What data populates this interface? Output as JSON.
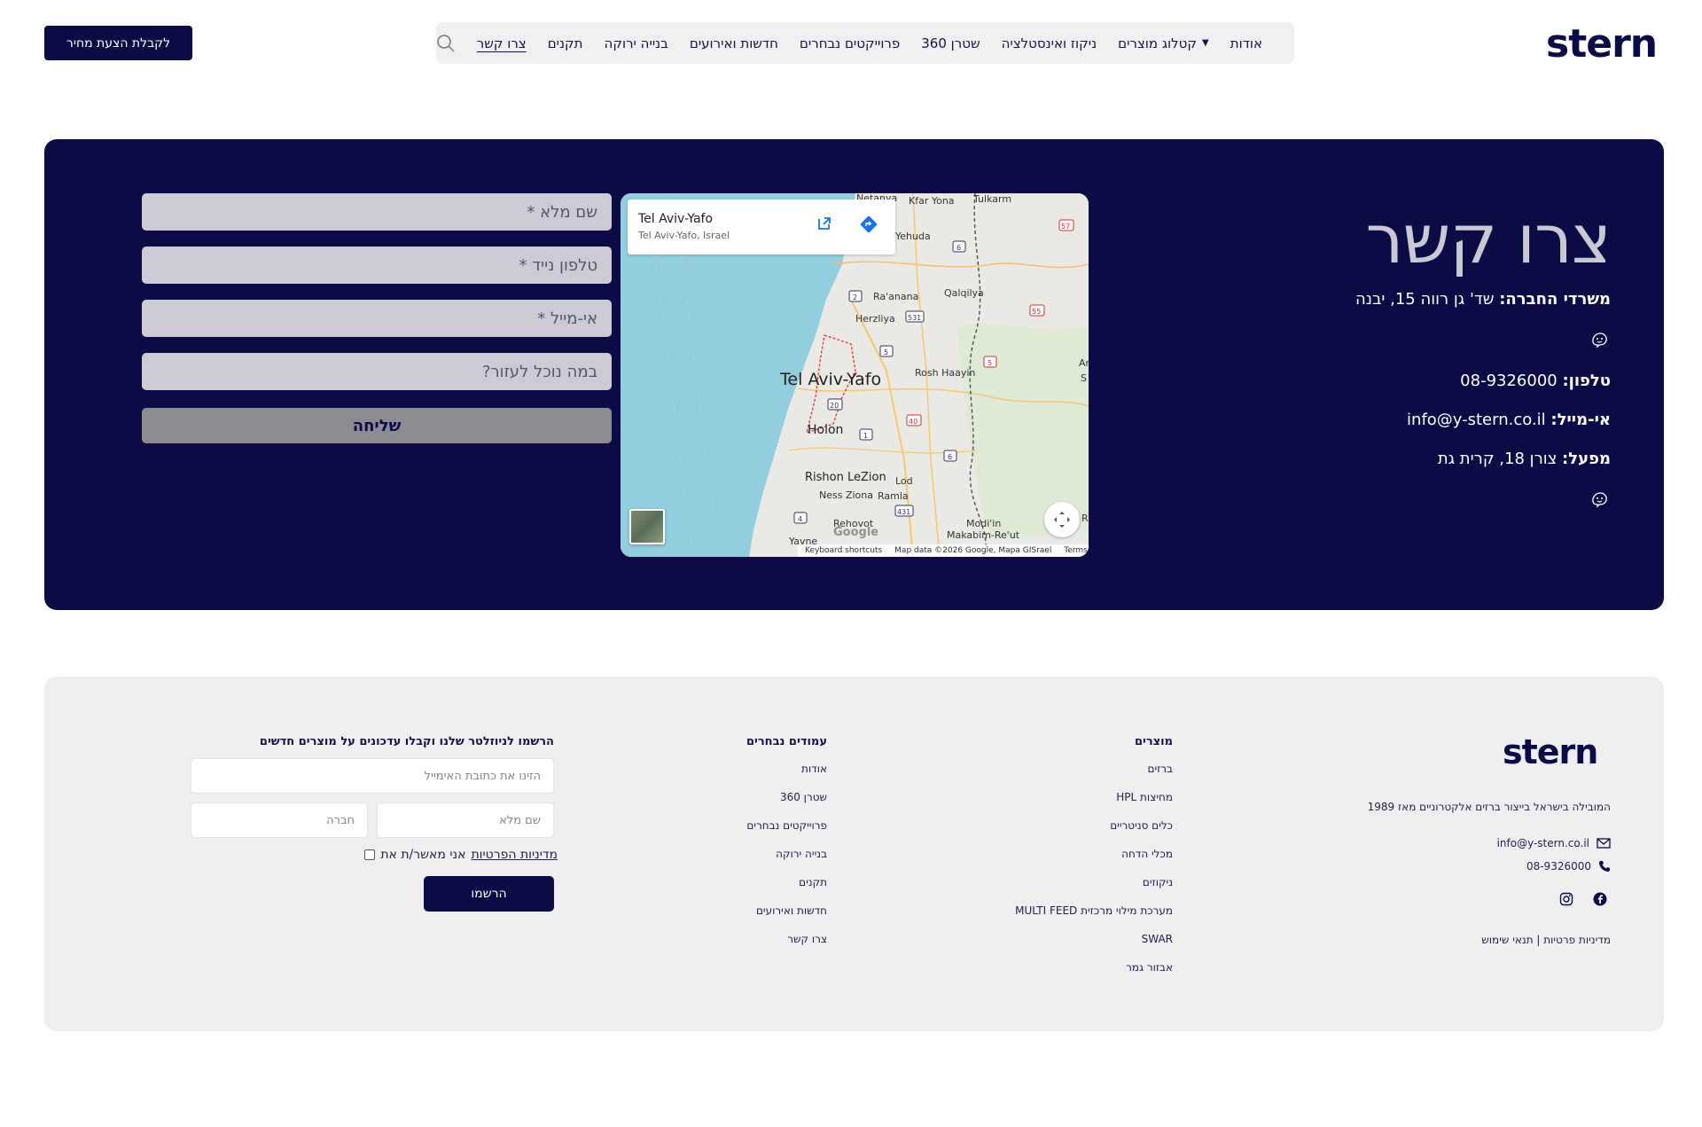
{
  "brand": {
    "logo_text": "stern",
    "color": "#0b0b45"
  },
  "header": {
    "nav": [
      {
        "label": "אודות",
        "has_dropdown": false
      },
      {
        "label": "קטלוג מוצרים",
        "has_dropdown": true
      },
      {
        "label": "ניקוז ואינסטלציה",
        "has_dropdown": false
      },
      {
        "label": "שטרן 360",
        "has_dropdown": false
      },
      {
        "label": "פרוייקטים נבחרים",
        "has_dropdown": false
      },
      {
        "label": "חדשות ואירועים",
        "has_dropdown": false
      },
      {
        "label": "בנייה ירוקה",
        "has_dropdown": false
      },
      {
        "label": "תקנים",
        "has_dropdown": false
      },
      {
        "label": "צרו קשר",
        "has_dropdown": false,
        "active": true
      }
    ],
    "search_icon": "search-icon",
    "quote_button": "לקבלת הצעת מחיר"
  },
  "contact": {
    "title": "צרו קשר",
    "offices_label": "משרדי החברה:",
    "offices_value": "שד' גן רווה 15, יבנה",
    "phone_label": "טלפון:",
    "phone_value": "08-9326000",
    "email_label": "אי-מייל:",
    "email_value": "info@y-stern.co.il",
    "factory_label": "מפעל:",
    "factory_value": "צורן 18, קרית גת",
    "waze_icon": "waze-icon"
  },
  "map": {
    "card_title": "Tel Aviv-Yafo",
    "card_subtitle": "Tel Aviv-Yafo, Israel",
    "labels": {
      "netanya": "Netanya",
      "kfar_yona": "Kfar Yona",
      "tulkarm": "Tulkarm",
      "yehuda": "Yehuda",
      "raanana": "Ra'anana",
      "qalqilya": "Qalqilya",
      "herzliya": "Herzliya",
      "tel_aviv": "Tel Aviv-Yafo",
      "rosh_haayin": "Rosh Haayin",
      "holon": "Holon",
      "rishon": "Rishon LeZion",
      "lod": "Lod",
      "ness_ziona": "Ness Ziona",
      "ramla": "Ramla",
      "rehovot": "Rehovot",
      "yavne": "Yavne",
      "modiin": "Modi'in",
      "makabim": "Makabim-Re'ut",
      "ar": "Ar",
      "s": "S",
      "r": "R"
    },
    "road_shields": [
      "57",
      "6",
      "2",
      "55",
      "531",
      "5",
      "5",
      "20",
      "40",
      "1",
      "6",
      "431",
      "4"
    ],
    "footer": [
      "Keyboard shortcuts",
      "Map data ©2026 Google, Mapa GISrael",
      "Terms"
    ],
    "google": "Google"
  },
  "form": {
    "full_name_placeholder": "שם מלא *",
    "mobile_placeholder": "טלפון נייד *",
    "email_placeholder": "אי-מייל *",
    "help_placeholder": "במה נוכל לעזור?",
    "submit_label": "שליחה"
  },
  "footer": {
    "tagline": "המובילה בישראל בייצור ברזים אלקטרוניים מאז 1989",
    "email": "info@y-stern.co.il",
    "phone": "08-9326000",
    "legal": "מדיניות פרטיות | תנאי שימוש",
    "products": {
      "heading": "מוצרים",
      "items": [
        "ברזים",
        "מחיצות HPL",
        "כלים סניטריים",
        "מכלי הדחה",
        "ניקוזים",
        "מערכת מילוי מרכזית MULTI FEED",
        "SWAR",
        "אבזור גמר"
      ]
    },
    "featured": {
      "heading": "עמודים נבחרים",
      "items": [
        "אודות",
        "שטרן 360",
        "פרוייקטים נבחרים",
        "בנייה ירוקה",
        "תקנים",
        "חדשות ואירועים",
        "צרו קשר"
      ]
    },
    "newsletter": {
      "heading": "הרשמו לניוזלטר שלנו וקבלו עדכונים על מוצרים חדשים",
      "email_placeholder": "הזינו את כתובת האימייל",
      "name_placeholder": "שם מלא",
      "company_placeholder": "חברה",
      "consent_prefix": "אני מאשר/ת את",
      "consent_link": "מדיניות הפרטיות",
      "submit_label": "הרשמו"
    }
  }
}
